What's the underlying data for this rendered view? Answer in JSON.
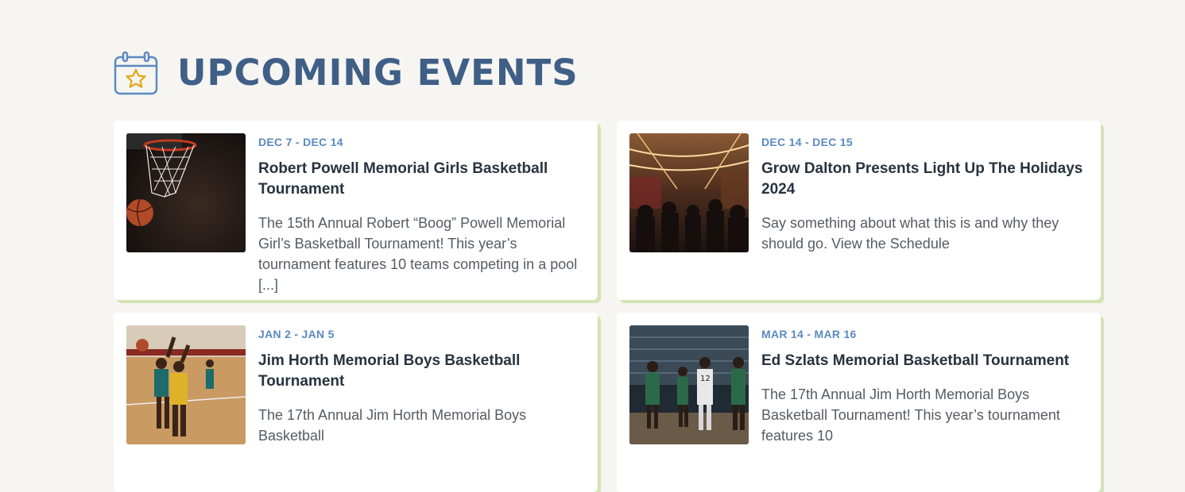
{
  "section": {
    "title": "UPCOMING EVENTS",
    "icon": "calendar-star-icon",
    "colors": {
      "title": "#3f5f87",
      "date": "#5b8ac0",
      "card_shadow": "#d3e3b4",
      "background": "#f6f5f1"
    }
  },
  "events": [
    {
      "date": "DEC 7 - DEC 14",
      "title": "Robert Powell Memorial Girls Basketball Tournament",
      "description": "The 15th Annual Robert “Boog” Powell Memorial Girl’s Basketball Tournament! This year’s tournament features 10 teams competing in a pool [...]",
      "image": "basketball-hoop-photo"
    },
    {
      "date": "DEC 14 - DEC 15",
      "title": "Grow Dalton Presents Light Up The Holidays 2024",
      "description": "Say something about what this is and why they should go. View the Schedule",
      "image": "holiday-lights-crowd-photo"
    },
    {
      "date": "JAN 2 - JAN 5",
      "title": "Jim Horth Memorial Boys Basketball Tournament",
      "description": "The 17th Annual Jim Horth Memorial Boys Basketball",
      "image": "boys-basketball-game-photo"
    },
    {
      "date": "MAR 14 - MAR 16",
      "title": "Ed Szlats Memorial Basketball Tournament",
      "description": "The 17th Annual Jim Horth Memorial Boys Basketball Tournament! This year’s tournament features 10",
      "image": "basketball-game-crowd-photo"
    }
  ]
}
